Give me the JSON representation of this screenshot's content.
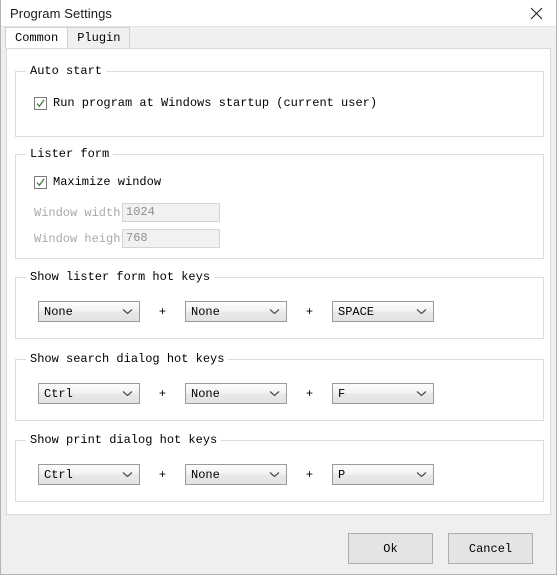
{
  "window": {
    "title": "Program Settings",
    "close_icon": "close-icon"
  },
  "tabs": [
    {
      "label": "Common",
      "active": true
    },
    {
      "label": "Plugin",
      "active": false
    }
  ],
  "groups": {
    "auto_start": {
      "label": "Auto start",
      "checkbox": {
        "label": "Run program at Windows startup (current user)",
        "checked": true
      }
    },
    "lister_form": {
      "label": "Lister form",
      "checkbox": {
        "label": "Maximize window",
        "checked": true
      },
      "fields": [
        {
          "label": "Window width:",
          "value": "1024",
          "disabled": true
        },
        {
          "label": "Window height:",
          "value": "768",
          "disabled": true
        }
      ]
    },
    "lister_hotkeys": {
      "label": "Show lister form hot keys",
      "separator": "+",
      "selects": [
        "None",
        "None",
        "SPACE"
      ]
    },
    "search_hotkeys": {
      "label": "Show search dialog hot keys",
      "separator": "+",
      "selects": [
        "Ctrl",
        "None",
        "F"
      ]
    },
    "print_hotkeys": {
      "label": "Show print dialog hot keys",
      "separator": "+",
      "selects": [
        "Ctrl",
        "None",
        "P"
      ]
    }
  },
  "footer": {
    "ok_label": "Ok",
    "cancel_label": "Cancel"
  },
  "colors": {
    "window_bg": "#efefef",
    "panel_bg": "#ffffff",
    "group_border": "#dcdcdc",
    "disabled_text": "#a9a9a9",
    "text": "#000000"
  }
}
